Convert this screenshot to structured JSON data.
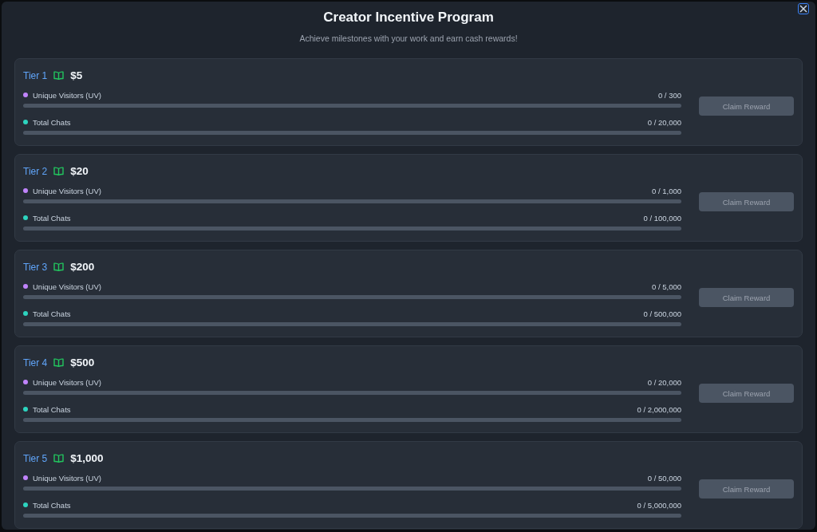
{
  "title": "Creator Incentive Program",
  "subtitle": "Achieve milestones with your work and earn cash rewards!",
  "tiers": [
    {
      "tier": "Tier 1",
      "reward": "$5",
      "button": {
        "label": "Claim Reward",
        "disabled": true
      },
      "metrics": [
        {
          "name": "Unique Visitors (UV)",
          "color": "#c084fc",
          "progress": "0 / 300",
          "level": 0
        },
        {
          "name": "Total Chats",
          "color": "#2dd4bf",
          "progress": "0 / 20,000",
          "level": 0
        }
      ]
    },
    {
      "tier": "Tier 2",
      "reward": "$20",
      "button": {
        "label": "Claim Reward",
        "disabled": true
      },
      "metrics": [
        {
          "name": "Unique Visitors (UV)",
          "color": "#c084fc",
          "progress": "0 / 1,000",
          "level": 0
        },
        {
          "name": "Total Chats",
          "color": "#2dd4bf",
          "progress": "0 / 100,000",
          "level": 0
        }
      ]
    },
    {
      "tier": "Tier 3",
      "reward": "$200",
      "button": {
        "label": "Claim Reward",
        "disabled": true
      },
      "metrics": [
        {
          "name": "Unique Visitors (UV)",
          "color": "#c084fc",
          "progress": "0 / 5,000",
          "level": 0
        },
        {
          "name": "Total Chats",
          "color": "#2dd4bf",
          "progress": "0 / 500,000",
          "level": 0
        }
      ]
    },
    {
      "tier": "Tier 4",
      "reward": "$500",
      "button": {
        "label": "Claim Reward",
        "disabled": true
      },
      "metrics": [
        {
          "name": "Unique Visitors (UV)",
          "color": "#c084fc",
          "progress": "0 / 20,000",
          "level": 0
        },
        {
          "name": "Total Chats",
          "color": "#2dd4bf",
          "progress": "0 / 2,000,000",
          "level": 0
        }
      ]
    },
    {
      "tier": "Tier 5",
      "reward": "$1,000",
      "button": {
        "label": "Claim Reward",
        "disabled": true
      },
      "metrics": [
        {
          "name": "Unique Visitors (UV)",
          "color": "#c084fc",
          "progress": "0 / 50,000",
          "level": 0
        },
        {
          "name": "Total Chats",
          "color": "#2dd4bf",
          "progress": "0 / 5,000,000",
          "level": 0
        }
      ]
    }
  ]
}
